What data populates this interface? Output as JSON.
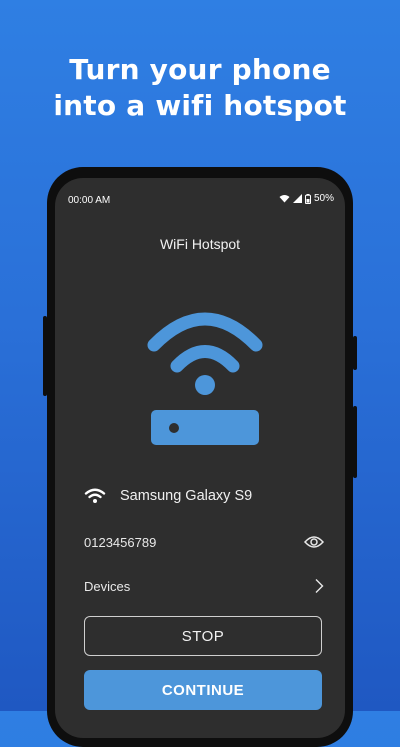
{
  "headline": {
    "line1": "Turn your phone",
    "line2": "into a wifi hotspot"
  },
  "status_bar": {
    "time": "00:00 AM",
    "battery": "50%",
    "icons": [
      "wifi-icon",
      "signal-icon",
      "battery-icon"
    ]
  },
  "app": {
    "title": "WiFi Hotspot",
    "hero_icon": "wifi-router-icon",
    "network_name": "Samsung Galaxy S9",
    "password": "0123456789",
    "devices_label": "Devices",
    "stop_label": "STOP",
    "continue_label": "CONTINUE"
  },
  "colors": {
    "background_top": "#2f7fe3",
    "background_bottom": "#1f58c2",
    "screen": "#2e2e2e",
    "accent": "#4d96da"
  }
}
